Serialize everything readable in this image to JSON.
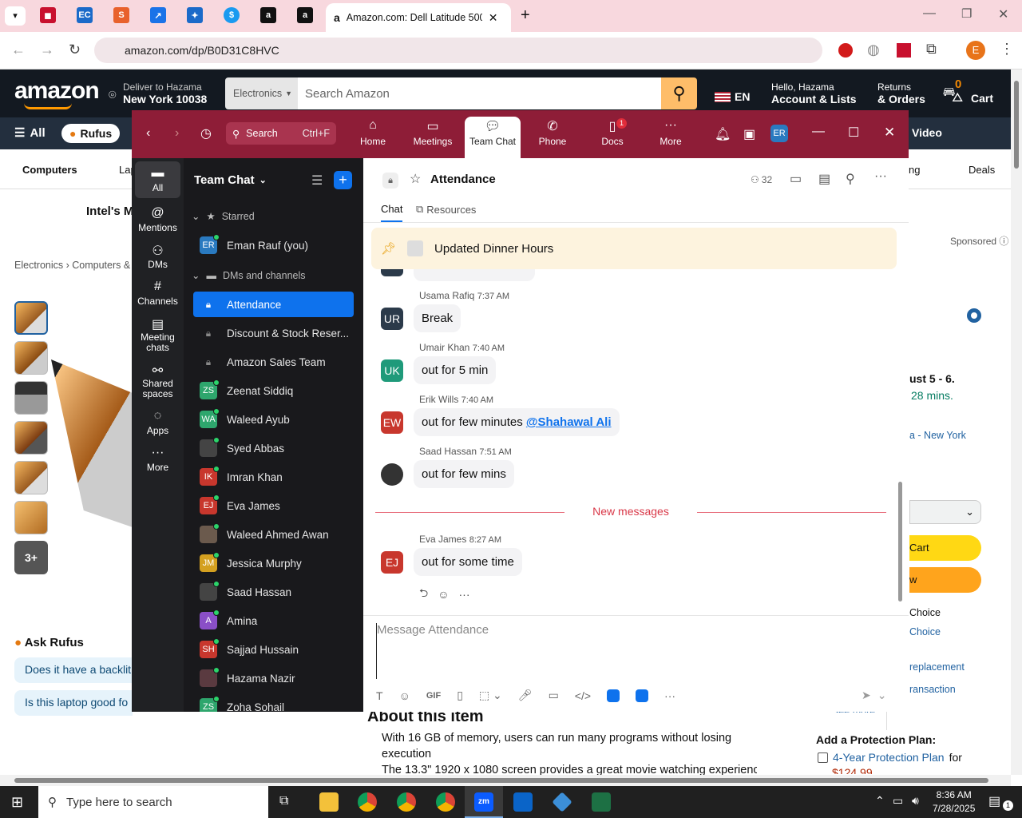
{
  "browser": {
    "active_tab_title": "Amazon.com: Dell Latitude 500",
    "url": "amazon.com/dp/B0D31C8HVC",
    "profile_initial": "E"
  },
  "amazon": {
    "logo": "amazon",
    "deliver_line1": "Deliver to Hazama",
    "deliver_line2": "New York 10038",
    "search_category": "Electronics",
    "search_placeholder": "Search Amazon",
    "lang": "EN",
    "account_line1": "Hello, Hazama",
    "account_line2": "Account & Lists",
    "returns_line1": "Returns",
    "returns_line2": "& Orders",
    "cart_count": "0",
    "cart_label": "Cart",
    "nav_all": "All",
    "nav_rufus": "Rufus",
    "nav_video": "Video",
    "cat_computers": "Computers",
    "cat_lap": "Lap",
    "cat_ng": "ng",
    "cat_deals": "Deals",
    "promo_text": "Intel's M",
    "sponsored": "Sponsored",
    "breadcrumb_1": "Electronics",
    "breadcrumb_2": "Computers &",
    "thumb_more": "3+",
    "delivery_date": "ust 5 - 6.",
    "delivery_time": "28 mins.",
    "delivery_loc": "a - New York",
    "add_cart": "Cart",
    "buy_now": "w",
    "choice_1": "Choice",
    "choice_2": "Choice",
    "replacement": "replacement",
    "transaction": "ransaction",
    "see_more": "See more",
    "ask_rufus": "Ask Rufus",
    "rufus_q1": "Does it have a backlit",
    "rufus_q2": "Is this laptop good fo",
    "about_title": "About this item",
    "about_b1": "With 16 GB of memory, users can run many programs without losing execution",
    "about_b2": "The 13.3\" 1920 x 1080 screen provides a great movie watching experience",
    "plan_title": "Add a Protection Plan:",
    "plan_item": "4-Year Protection Plan",
    "plan_for": "for",
    "plan_price": "$124.99"
  },
  "zoom": {
    "search": "Search",
    "search_shortcut": "Ctrl+F",
    "tabs": [
      {
        "label": "Home"
      },
      {
        "label": "Meetings"
      },
      {
        "label": "Team Chat"
      },
      {
        "label": "Phone"
      },
      {
        "label": "Docs",
        "badge": "1"
      },
      {
        "label": "More"
      }
    ],
    "user_initials": "ER",
    "side": [
      {
        "label": "All"
      },
      {
        "label": "Mentions"
      },
      {
        "label": "DMs"
      },
      {
        "label": "Channels"
      },
      {
        "label": "Meeting chats"
      },
      {
        "label": "Shared spaces"
      },
      {
        "label": "Apps"
      },
      {
        "label": "More"
      }
    ],
    "list_title": "Team Chat",
    "starred_header": "Starred",
    "dms_header": "DMs and channels",
    "starred": [
      {
        "initials": "ER",
        "name": "Eman Rauf (you)",
        "color": "#2a7ac0"
      }
    ],
    "channels": [
      {
        "name": "Attendance",
        "type": "lock"
      },
      {
        "name": "Discount & Stock Reser...",
        "type": "lock"
      },
      {
        "name": "Amazon Sales Team",
        "type": "lock"
      },
      {
        "name": "Zeenat Siddiq",
        "initials": "ZS",
        "color": "#2ea66d"
      },
      {
        "name": "Waleed Ayub",
        "initials": "WA",
        "color": "#2ea66d"
      },
      {
        "name": "Syed Abbas",
        "initials": "",
        "color": "#444"
      },
      {
        "name": "Imran Khan",
        "initials": "IK",
        "color": "#c8372d"
      },
      {
        "name": "Eva James",
        "initials": "EJ",
        "color": "#c8372d"
      },
      {
        "name": "Waleed Ahmed Awan",
        "initials": "",
        "color": "#6b5a4d"
      },
      {
        "name": "Jessica Murphy",
        "initials": "JM",
        "color": "#d4a020"
      },
      {
        "name": "Saad Hassan",
        "initials": "",
        "color": "#444"
      },
      {
        "name": "Amina",
        "initials": "A",
        "color": "#8a4fc7"
      },
      {
        "name": "Sajjad Hussain",
        "initials": "SH",
        "color": "#c8372d"
      },
      {
        "name": "Hazama Nazir",
        "initials": "",
        "color": "#5a3a40"
      },
      {
        "name": "Zoha Sohail",
        "initials": "ZS",
        "color": "#2ea66d"
      }
    ],
    "channel_title": "Attendance",
    "member_count": "32",
    "subtab_chat": "Chat",
    "subtab_resources": "Resources",
    "pinned": "Updated Dinner Hours",
    "messages": [
      {
        "initials": "UR",
        "name": "Usama Rafiq",
        "time": "7:37 AM",
        "text": "Break",
        "color": "#2b3a4a"
      },
      {
        "initials": "UK",
        "name": "Umair Khan",
        "time": "7:40 AM",
        "text": "out for 5 min",
        "color": "#1f9a7a"
      },
      {
        "initials": "EW",
        "name": "Erik Wills",
        "time": "7:40 AM",
        "text": "out for few minutes",
        "mention": "@Shahawal Ali",
        "color": "#c8372d"
      },
      {
        "initials": "",
        "name": "Saad Hassan",
        "time": "7:51 AM",
        "text": "out for few mins",
        "color": "#333"
      },
      {
        "initials": "EJ",
        "name": "Eva James",
        "time": "8:27 AM",
        "text": "out for some time",
        "color": "#c8372d"
      }
    ],
    "new_messages": "New messages",
    "compose_placeholder": "Message Attendance"
  },
  "taskbar": {
    "search_placeholder": "Type here to search",
    "time": "8:36 AM",
    "date": "7/28/2025",
    "notif_count": "1"
  }
}
